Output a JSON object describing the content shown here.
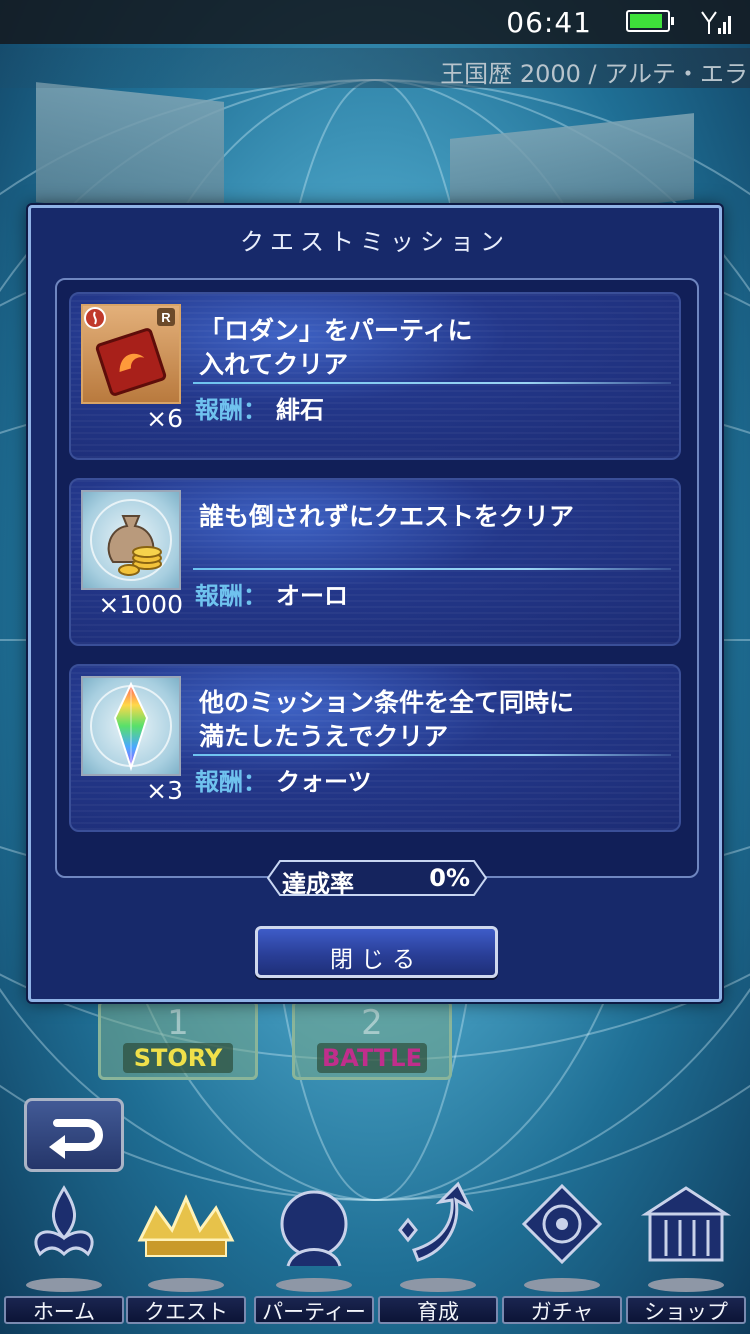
{
  "status_bar": {
    "time": "06:41",
    "battery_level": 0.9
  },
  "header": {
    "era": "王国歴 2000 / アルテ・エラ"
  },
  "modal": {
    "title": "クエストミッション",
    "missions": [
      {
        "condition": "「ロダン」をパーティに\n入れてクリア",
        "reward_label": "報酬：",
        "reward_name": "緋石",
        "quantity": "×6",
        "icon": "red-stone-icon"
      },
      {
        "condition": "誰も倒されずにクエストをクリア",
        "reward_label": "報酬：",
        "reward_name": "オーロ",
        "quantity": "×1000",
        "icon": "gold-bag-icon"
      },
      {
        "condition": "他のミッション条件を全て同時に\n満たしたうえでクリア",
        "reward_label": "報酬：",
        "reward_name": "クォーツ",
        "quantity": "×3",
        "icon": "quartz-crystal-icon"
      }
    ],
    "completion": {
      "label": "達成率",
      "value": "0%"
    },
    "close_label": "閉じる"
  },
  "background": {
    "chapters": [
      {
        "number": "1",
        "label": "STORY",
        "color": "#f0e04a"
      },
      {
        "number": "2",
        "label": "BATTLE",
        "color": "#c02e8c"
      }
    ]
  },
  "nav": {
    "items": [
      {
        "label": "ホーム",
        "icon": "home-fleur-icon"
      },
      {
        "label": "クエスト",
        "icon": "quest-crown-icon"
      },
      {
        "label": "パーティー",
        "icon": "party-portrait-icon"
      },
      {
        "label": "育成",
        "icon": "growth-arrow-icon"
      },
      {
        "label": "ガチャ",
        "icon": "gacha-emblem-icon"
      },
      {
        "label": "ショップ",
        "icon": "shop-building-icon"
      }
    ]
  }
}
